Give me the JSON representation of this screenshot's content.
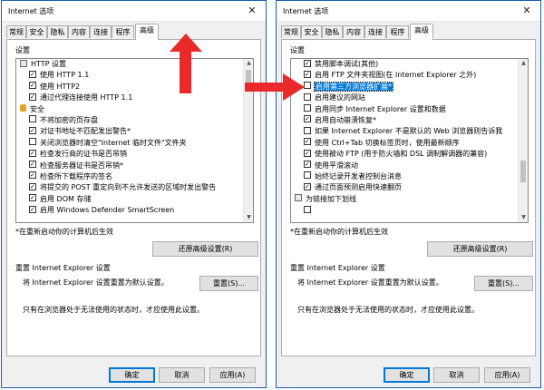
{
  "accent_color": "#e82a2a",
  "left_window": {
    "title": "Internet 选项",
    "close_glyph": "✕",
    "tabs": [
      {
        "label": "常规"
      },
      {
        "label": "安全"
      },
      {
        "label": "隐私"
      },
      {
        "label": "内容"
      },
      {
        "label": "连接"
      },
      {
        "label": "程序"
      },
      {
        "label": "高级"
      }
    ],
    "active_tab": "高级",
    "settings_label": "设置",
    "items": [
      {
        "icon": "folder",
        "label": "HTTP 设置",
        "indent": 0,
        "checked": false
      },
      {
        "icon": "checkbox",
        "label": "使用 HTTP 1.1",
        "indent": 1,
        "checked": true
      },
      {
        "icon": "checkbox",
        "label": "使用 HTTP2",
        "indent": 1,
        "checked": true
      },
      {
        "icon": "checkbox",
        "label": "通过代理连接使用 HTTP 1.1",
        "indent": 1,
        "checked": true
      },
      {
        "icon": "lock",
        "label": "安全",
        "indent": 0,
        "checked": false
      },
      {
        "icon": "checkbox",
        "label": "不将加密的页存盘",
        "indent": 1,
        "checked": false
      },
      {
        "icon": "checkbox",
        "label": "对证书地址不匹配发出警告*",
        "indent": 1,
        "checked": true
      },
      {
        "icon": "checkbox",
        "label": "关闭浏览器时清空\"Internet 临时文件\"文件夹",
        "indent": 1,
        "checked": false
      },
      {
        "icon": "checkbox",
        "label": "检查发行商的证书是否吊销",
        "indent": 1,
        "checked": true
      },
      {
        "icon": "checkbox",
        "label": "检查服务器证书是否吊销*",
        "indent": 1,
        "checked": true
      },
      {
        "icon": "checkbox",
        "label": "检查所下载程序的签名",
        "indent": 1,
        "checked": true
      },
      {
        "icon": "checkbox",
        "label": "将提交的 POST 重定向到不允许发送的区域时发出警告",
        "indent": 1,
        "checked": true
      },
      {
        "icon": "checkbox",
        "label": "启用 DOM 存储",
        "indent": 1,
        "checked": true
      },
      {
        "icon": "checkbox",
        "label": "启用 Windows Defender SmartScreen",
        "indent": 1,
        "checked": true
      }
    ],
    "restart_note": "*在重新启动你的计算机后生效",
    "restore_button": "还原高级设置(R)",
    "reset_title": "重置 Internet Explorer 设置",
    "reset_text": "将 Internet Explorer 设置重置为默认设置。",
    "reset_button": "重置(S)...",
    "reset_warn": "只有在浏览器处于无法使用的状态时，才应使用此设置。",
    "ok_button": "确定",
    "cancel_button": "取消",
    "apply_button": "应用(A)"
  },
  "right_window": {
    "title": "Internet 选项",
    "close_glyph": "✕",
    "tabs": [
      {
        "label": "常规"
      },
      {
        "label": "安全"
      },
      {
        "label": "隐私"
      },
      {
        "label": "内容"
      },
      {
        "label": "连接"
      },
      {
        "label": "程序"
      },
      {
        "label": "高级"
      }
    ],
    "active_tab": "高级",
    "settings_label": "设置",
    "items": [
      {
        "icon": "checkbox",
        "label": "禁用脚本调试(其他)",
        "indent": 1,
        "checked": true
      },
      {
        "icon": "checkbox",
        "label": "启用 FTP 文件夹视图(在 Internet Explorer 之外)",
        "indent": 1,
        "checked": true
      },
      {
        "icon": "checkbox",
        "label": "启用第三方浏览器扩展*",
        "indent": 1,
        "checked": false,
        "highlight": true
      },
      {
        "icon": "checkbox",
        "label": "启用建议的网站",
        "indent": 1,
        "checked": false
      },
      {
        "icon": "checkbox",
        "label": "启用同步 Internet Explorer 设置和数据",
        "indent": 1,
        "checked": false
      },
      {
        "icon": "checkbox",
        "label": "启用自动崩溃恢复*",
        "indent": 1,
        "checked": true
      },
      {
        "icon": "checkbox",
        "label": "如果 Internet Explorer 不是默认的 Web 浏览器则告诉我",
        "indent": 1,
        "checked": false
      },
      {
        "icon": "checkbox",
        "label": "使用 Ctrl+Tab 切换标签页时，使用最新顺序",
        "indent": 1,
        "checked": true
      },
      {
        "icon": "checkbox",
        "label": "使用被动 FTP (用于防火墙和 DSL 调制解调器的兼容)",
        "indent": 1,
        "checked": true
      },
      {
        "icon": "checkbox",
        "label": "使用平滑滚动",
        "indent": 1,
        "checked": true
      },
      {
        "icon": "checkbox",
        "label": "始终记录开发者控制台消息",
        "indent": 1,
        "checked": false
      },
      {
        "icon": "checkbox",
        "label": "通过页面预测启用快速翻页",
        "indent": 1,
        "checked": true
      },
      {
        "icon": "folder",
        "label": "为链接加下划线",
        "indent": 0,
        "checked": false
      },
      {
        "icon": "checkbox",
        "label": "",
        "indent": 1,
        "checked": false
      }
    ],
    "restart_note": "*在重新启动你的计算机后生效",
    "restore_button": "还原高级设置(R)",
    "reset_title": "重置 Internet Explorer 设置",
    "reset_text": "将 Internet Explorer 设置重置为默认设置。",
    "reset_button": "重置(S)...",
    "reset_warn": "只有在浏览器处于无法使用的状态时，才应使用此设置。",
    "ok_button": "确定",
    "cancel_button": "取消",
    "apply_button": "应用(A)"
  }
}
